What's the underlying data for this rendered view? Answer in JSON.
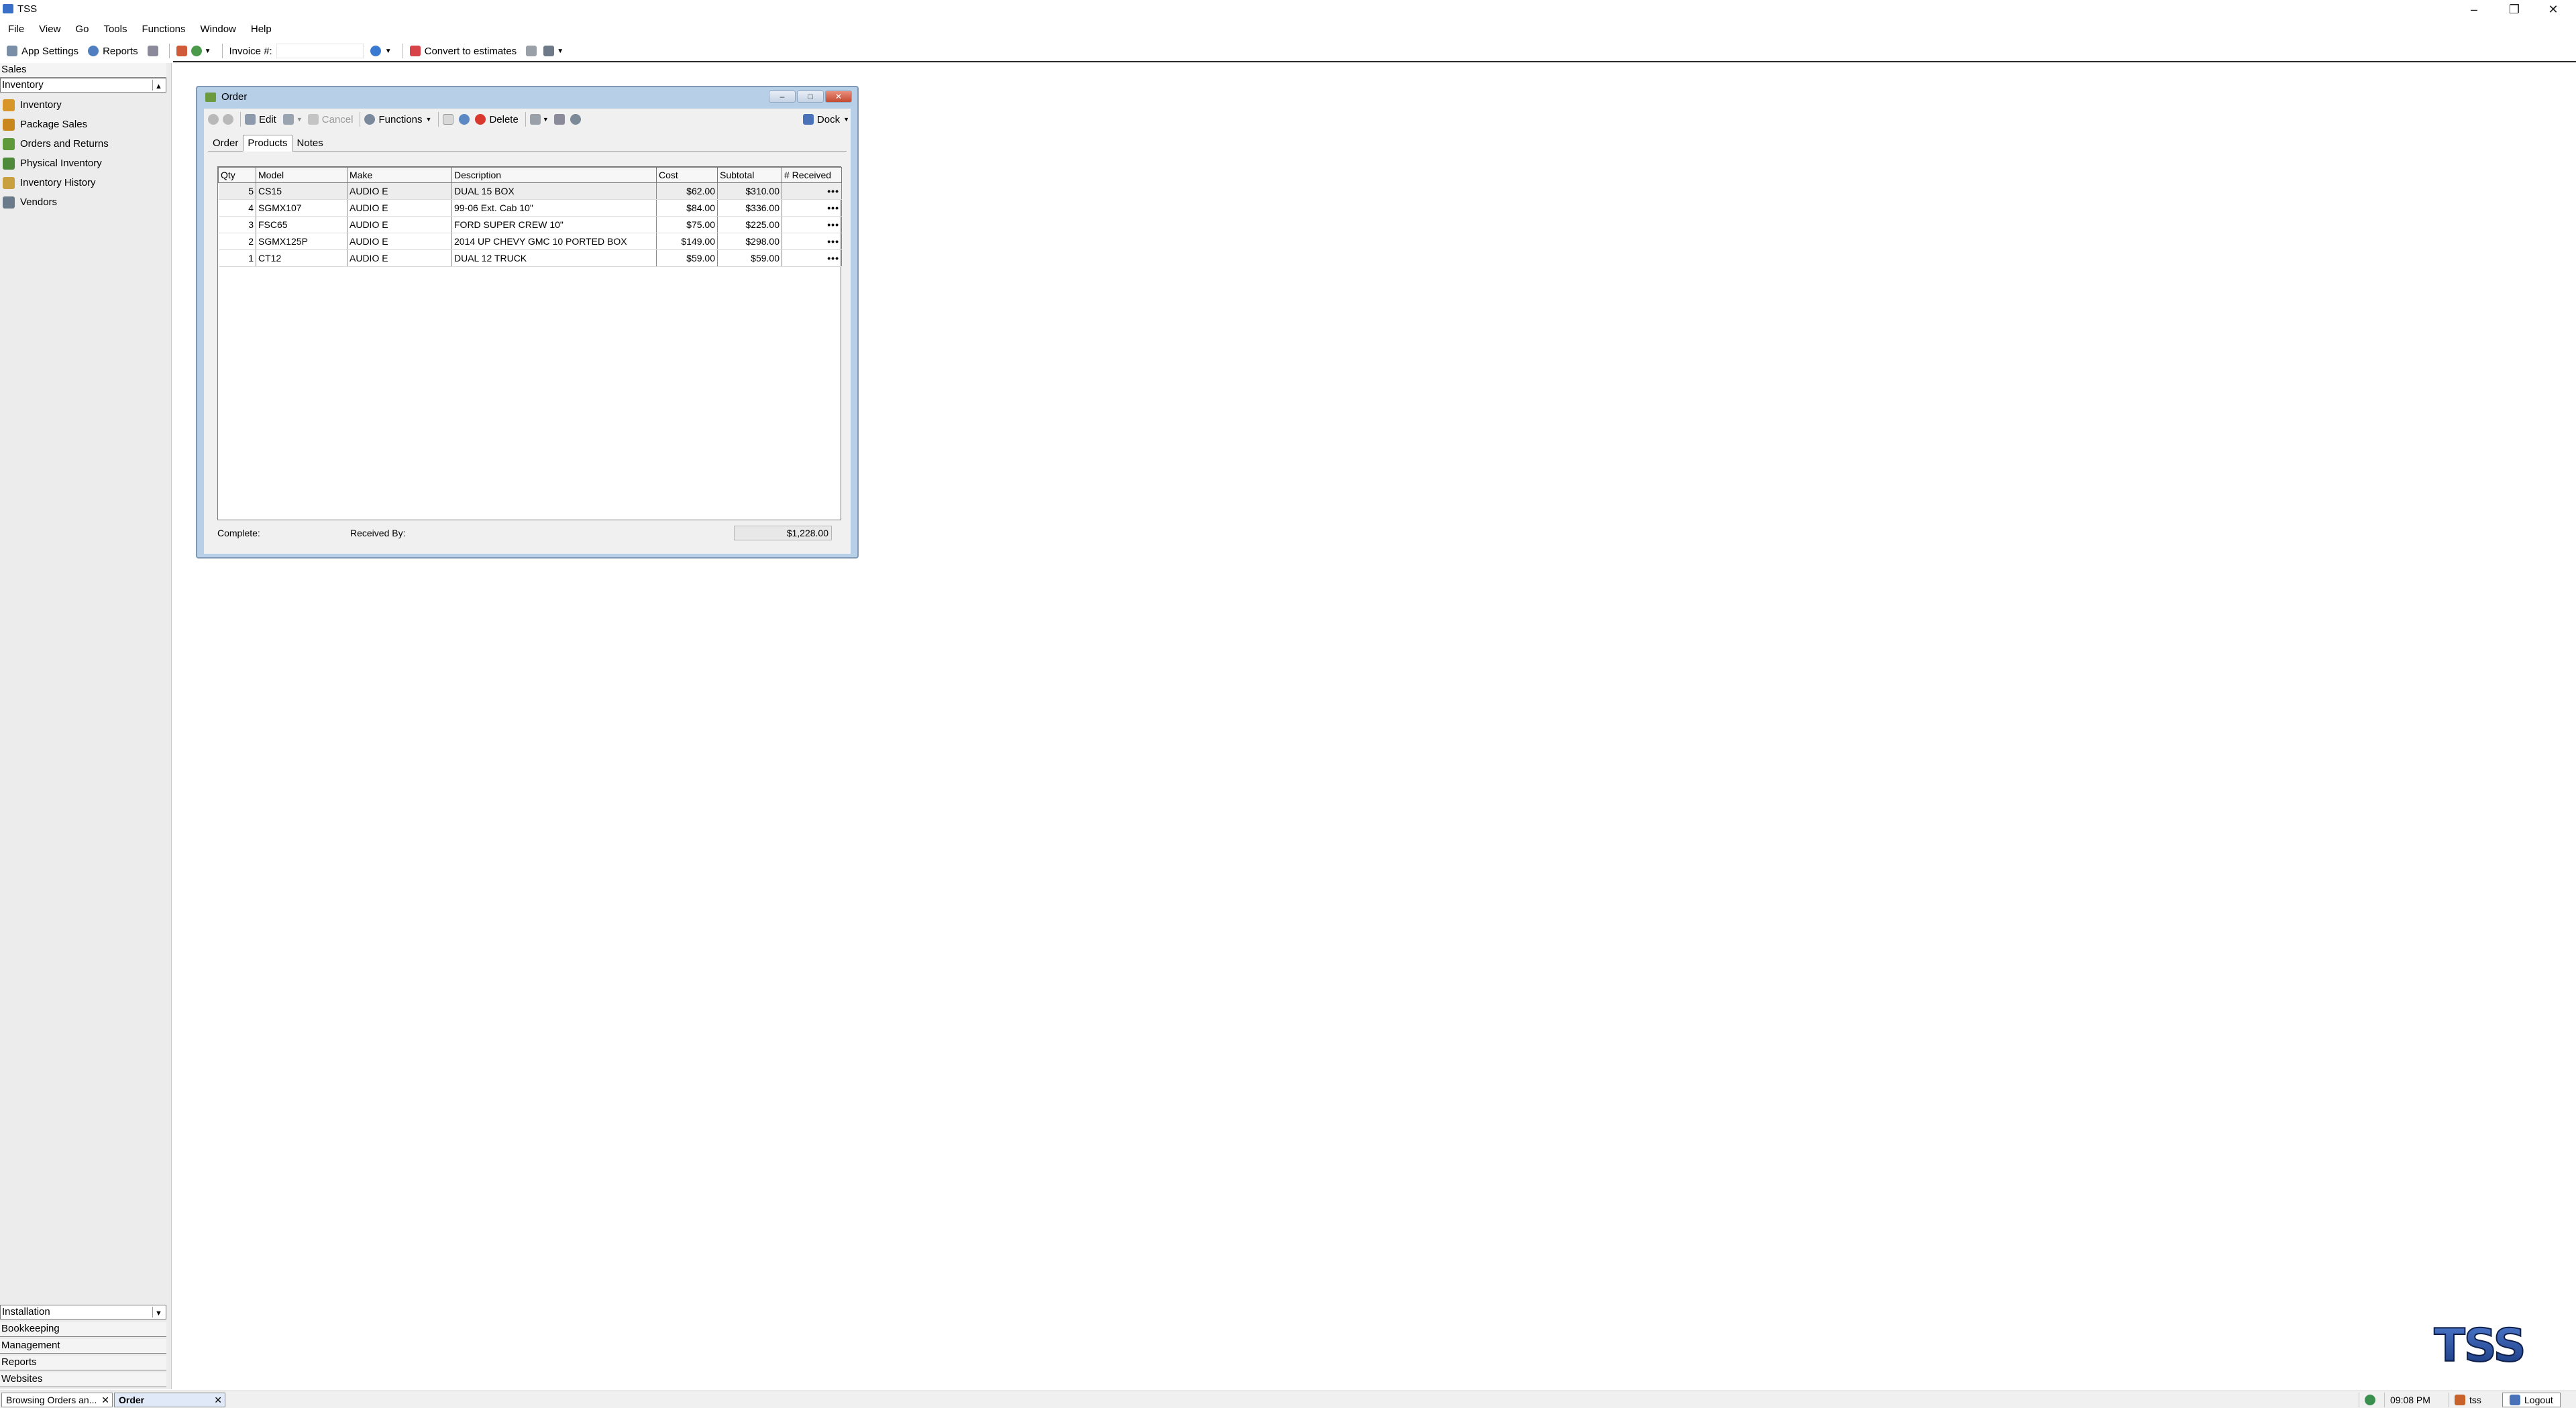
{
  "window": {
    "title": "TSS"
  },
  "menu": [
    "File",
    "View",
    "Go",
    "Tools",
    "Functions",
    "Window",
    "Help"
  ],
  "toolbar": {
    "app_settings": "App Settings",
    "reports": "Reports",
    "invoice_label": "Invoice #:",
    "invoice_value": "",
    "convert": "Convert to estimates"
  },
  "sidebar": {
    "sections_top": [
      "Sales"
    ],
    "open_section": "Inventory",
    "items": [
      {
        "label": "Inventory",
        "icon": "box-icon",
        "color": "#d8952a"
      },
      {
        "label": "Package Sales",
        "icon": "package-icon",
        "color": "#c8861d"
      },
      {
        "label": "Orders and Returns",
        "icon": "orders-icon",
        "color": "#5f9a3a"
      },
      {
        "label": "Physical Inventory",
        "icon": "clipboard-icon",
        "color": "#4f8a3a"
      },
      {
        "label": "Inventory History",
        "icon": "history-icon",
        "color": "#c9a040"
      },
      {
        "label": "Vendors",
        "icon": "vendors-icon",
        "color": "#6a7a8a"
      }
    ],
    "sections_bottom": [
      "Installation",
      "Bookkeeping",
      "Management",
      "Reports",
      "Websites"
    ]
  },
  "order_window": {
    "title": "Order",
    "toolbar": {
      "edit": "Edit",
      "cancel": "Cancel",
      "functions": "Functions",
      "delete": "Delete",
      "dock": "Dock"
    },
    "tabs": [
      "Order",
      "Products",
      "Notes"
    ],
    "active_tab": "Products",
    "columns": [
      "Qty",
      "Model",
      "Make",
      "Description",
      "Cost",
      "Subtotal",
      "# Received"
    ],
    "rows": [
      {
        "qty": "5",
        "model": "CS15",
        "make": "AUDIO E",
        "description": "DUAL 15 BOX",
        "cost": "$62.00",
        "subtotal": "$310.00",
        "received": "•••"
      },
      {
        "qty": "4",
        "model": "SGMX107",
        "make": "AUDIO E",
        "description": "99-06 Ext. Cab 10\"",
        "cost": "$84.00",
        "subtotal": "$336.00",
        "received": "•••"
      },
      {
        "qty": "3",
        "model": "FSC65",
        "make": "AUDIO E",
        "description": "FORD SUPER CREW 10\"",
        "cost": "$75.00",
        "subtotal": "$225.00",
        "received": "•••"
      },
      {
        "qty": "2",
        "model": "SGMX125P",
        "make": "AUDIO E",
        "description": "2014 UP CHEVY GMC 10 PORTED BOX",
        "cost": "$149.00",
        "subtotal": "$298.00",
        "received": "•••"
      },
      {
        "qty": "1",
        "model": "CT12",
        "make": "AUDIO E",
        "description": "DUAL 12 TRUCK",
        "cost": "$59.00",
        "subtotal": "$59.00",
        "received": "•••"
      }
    ],
    "footer": {
      "complete_label": "Complete:",
      "received_by_label": "Received By:",
      "total": "$1,228.00"
    }
  },
  "logo_text": "TSS",
  "bottombar": {
    "doc_tabs": [
      "Browsing Orders an...",
      "Order"
    ],
    "time": "09:08 PM",
    "user": "tss",
    "logout": "Logout"
  }
}
